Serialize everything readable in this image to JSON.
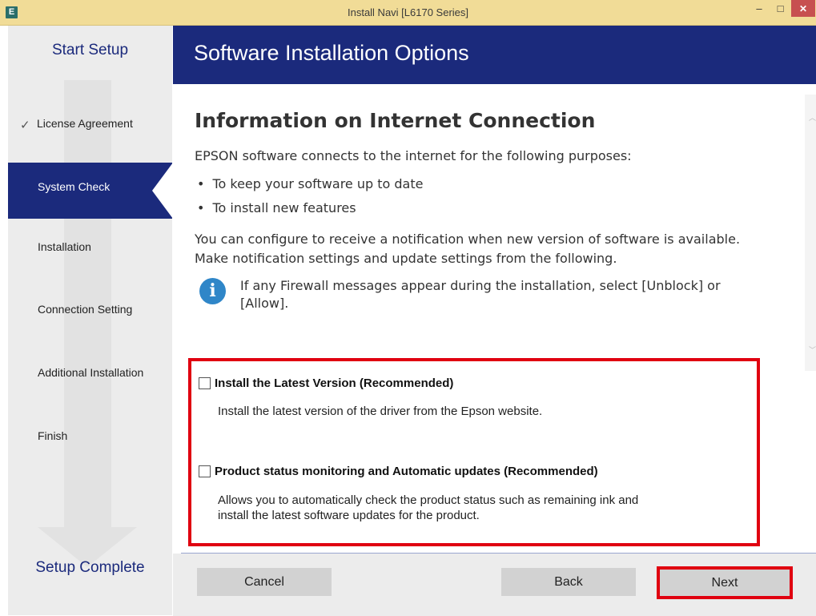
{
  "window": {
    "title": "Install Navi [L6170 Series]",
    "icon_letter": "E",
    "controls": {
      "minimize": "–",
      "maximize": "□",
      "close": "✕"
    }
  },
  "sidebar": {
    "start_label": "Start Setup",
    "complete_label": "Setup Complete",
    "steps": [
      {
        "label": "License Agreement",
        "state": "done"
      },
      {
        "label": "System Check",
        "state": "active"
      },
      {
        "label": "Installation",
        "state": "pending"
      },
      {
        "label": "Connection Setting",
        "state": "pending"
      },
      {
        "label": "Additional Installation",
        "state": "pending"
      },
      {
        "label": "Finish",
        "state": "pending"
      }
    ]
  },
  "header": {
    "title": "Software Installation Options"
  },
  "content": {
    "heading": "Information on Internet Connection",
    "intro": "EPSON software connects to the internet for the following purposes:",
    "bullets": [
      "To keep your software up to date",
      "To install new features"
    ],
    "configure_line1": "You can configure to receive a notification when new version of software is available.",
    "configure_line2": "Make notification settings and update settings from the following.",
    "firewall_line1": "If any Firewall messages appear during the installation, select [Unblock] or",
    "firewall_line2": "[Allow]."
  },
  "options": [
    {
      "label": "Install the Latest Version (Recommended)",
      "checked": false,
      "desc_line1": "Install the latest version of the driver from the Epson website."
    },
    {
      "label": "Product status monitoring and Automatic updates (Recommended)",
      "checked": false,
      "desc_line1": "Allows you to automatically check the product status such as remaining ink and",
      "desc_line2": "install the latest software updates for the product."
    }
  ],
  "buttons": {
    "cancel": "Cancel",
    "back": "Back",
    "next": "Next"
  },
  "colors": {
    "brand_blue": "#1b2a7c",
    "highlight_red": "#e00010",
    "title_bar": "#f1dc97"
  }
}
